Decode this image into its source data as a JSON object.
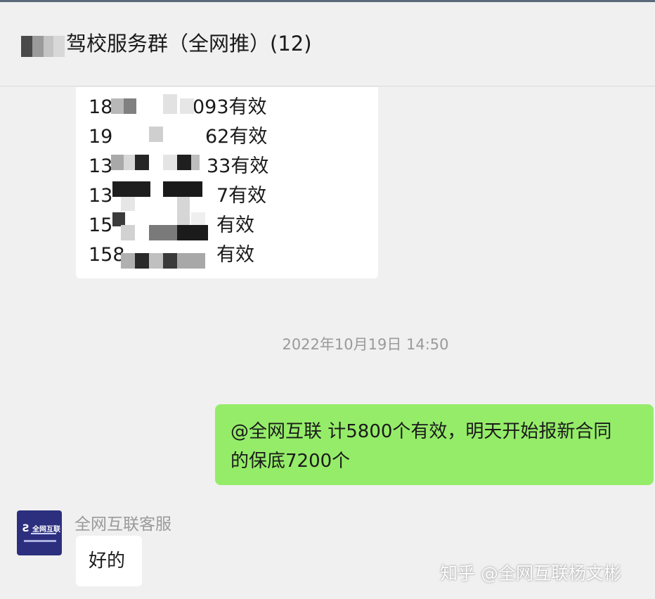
{
  "header": {
    "title_visible": "驾校服务群（全网推）(12)"
  },
  "contact_list": {
    "rows": [
      {
        "prefix": "18",
        "suffix": "093有效"
      },
      {
        "prefix": "19",
        "suffix": "62有效"
      },
      {
        "prefix": "13",
        "suffix": "33有效"
      },
      {
        "prefix": "13",
        "suffix": "7有效"
      },
      {
        "prefix": "15",
        "suffix": "有效"
      },
      {
        "prefix": "158",
        "suffix": "有效"
      }
    ]
  },
  "timestamp": "2022年10月19日 14:50",
  "outgoing_message": {
    "line1": "@全网互联 计5800个有效，明天开始报新合同",
    "line2": "的保底7200个"
  },
  "incoming_message": {
    "sender": "全网互联客服",
    "text": "好的",
    "avatar_label": "全网互联"
  },
  "watermark": "知乎 @全网互联杨文彬",
  "colors": {
    "background": "#f0f0f0",
    "outgoing_bubble": "#95ec69",
    "incoming_bubble": "#ffffff",
    "avatar_bg": "#2b2f7e",
    "meta_text": "#9a9a9a"
  }
}
